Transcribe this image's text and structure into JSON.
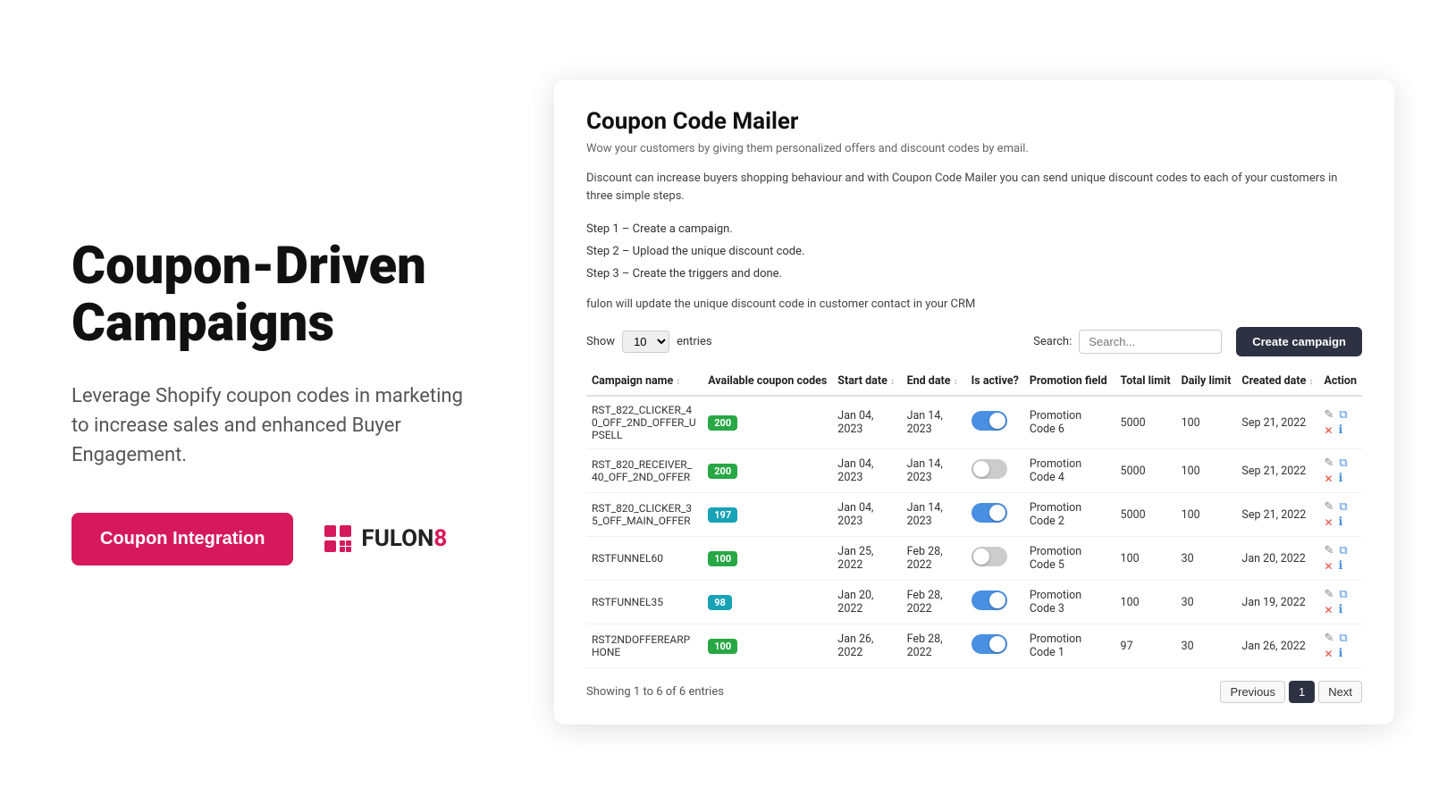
{
  "left": {
    "heading_line1": "Coupon-Driven",
    "heading_line2": "Campaigns",
    "subtext": "Leverage Shopify coupon codes in marketing to increase sales and enhanced Buyer Engagement.",
    "cta_label": "Coupon Integration",
    "logo_text": "FULON",
    "logo_accent": "8"
  },
  "right": {
    "card_title": "Coupon Code Mailer",
    "card_subtitle": "Wow your customers by giving them personalized offers and discount codes by email.",
    "card_desc": "Discount can increase buyers shopping behaviour and with Coupon Code Mailer you can send unique discount codes to each of your customers in three simple steps.",
    "steps": [
      "Step 1 – Create a campaign.",
      "Step 2 – Upload the unique discount code.",
      "Step 3 – Create the triggers and done."
    ],
    "note": "fulon will update the unique discount code in customer contact in your CRM",
    "show_label": "Show",
    "entries_value": "10",
    "entries_label": "entries",
    "search_label": "Search:",
    "search_placeholder": "Search...",
    "create_btn_label": "Create campaign",
    "table": {
      "columns": [
        "Campaign name",
        "Available coupon codes",
        "Start date",
        "End date",
        "Is active?",
        "Promotion field",
        "Total limit",
        "Daily limit",
        "Created date",
        "Action"
      ],
      "rows": [
        {
          "name": "RST_822_CLICKER_40_OFF_2ND_OFFER_UPSELL",
          "badge": "200",
          "badge_color": "green",
          "start": "Jan 04, 2023",
          "end": "Jan 14, 2023",
          "active": true,
          "promo": "Promotion Code 6",
          "total": "5000",
          "daily": "100",
          "created": "Sep 21, 2022"
        },
        {
          "name": "RST_820_RECEIVER_40_OFF_2ND_OFFER",
          "badge": "200",
          "badge_color": "green",
          "start": "Jan 04, 2023",
          "end": "Jan 14, 2023",
          "active": false,
          "promo": "Promotion Code 4",
          "total": "5000",
          "daily": "100",
          "created": "Sep 21, 2022"
        },
        {
          "name": "RST_820_CLICKER_35_OFF_MAIN_OFFER",
          "badge": "197",
          "badge_color": "teal",
          "start": "Jan 04, 2023",
          "end": "Jan 14, 2023",
          "active": true,
          "promo": "Promotion Code 2",
          "total": "5000",
          "daily": "100",
          "created": "Sep 21, 2022"
        },
        {
          "name": "RSTFUNNEL60",
          "badge": "100",
          "badge_color": "green",
          "start": "Jan 25, 2022",
          "end": "Feb 28, 2022",
          "active": false,
          "promo": "Promotion Code 5",
          "total": "100",
          "daily": "30",
          "created": "Jan 20, 2022"
        },
        {
          "name": "RSTFUNNEL35",
          "badge": "98",
          "badge_color": "teal",
          "start": "Jan 20, 2022",
          "end": "Feb 28, 2022",
          "active": true,
          "promo": "Promotion Code 3",
          "total": "100",
          "daily": "30",
          "created": "Jan 19, 2022"
        },
        {
          "name": "RST2NDOFFEREARPHONE",
          "badge": "100",
          "badge_color": "green",
          "start": "Jan 26, 2022",
          "end": "Feb 28, 2022",
          "active": true,
          "promo": "Promotion Code 1",
          "total": "97",
          "daily": "30",
          "created": "Jan 26, 2022"
        }
      ]
    },
    "footer_text": "Showing 1 to 6 of 6 entries",
    "pagination": {
      "prev": "Previous",
      "next": "Next",
      "current": "1"
    }
  }
}
